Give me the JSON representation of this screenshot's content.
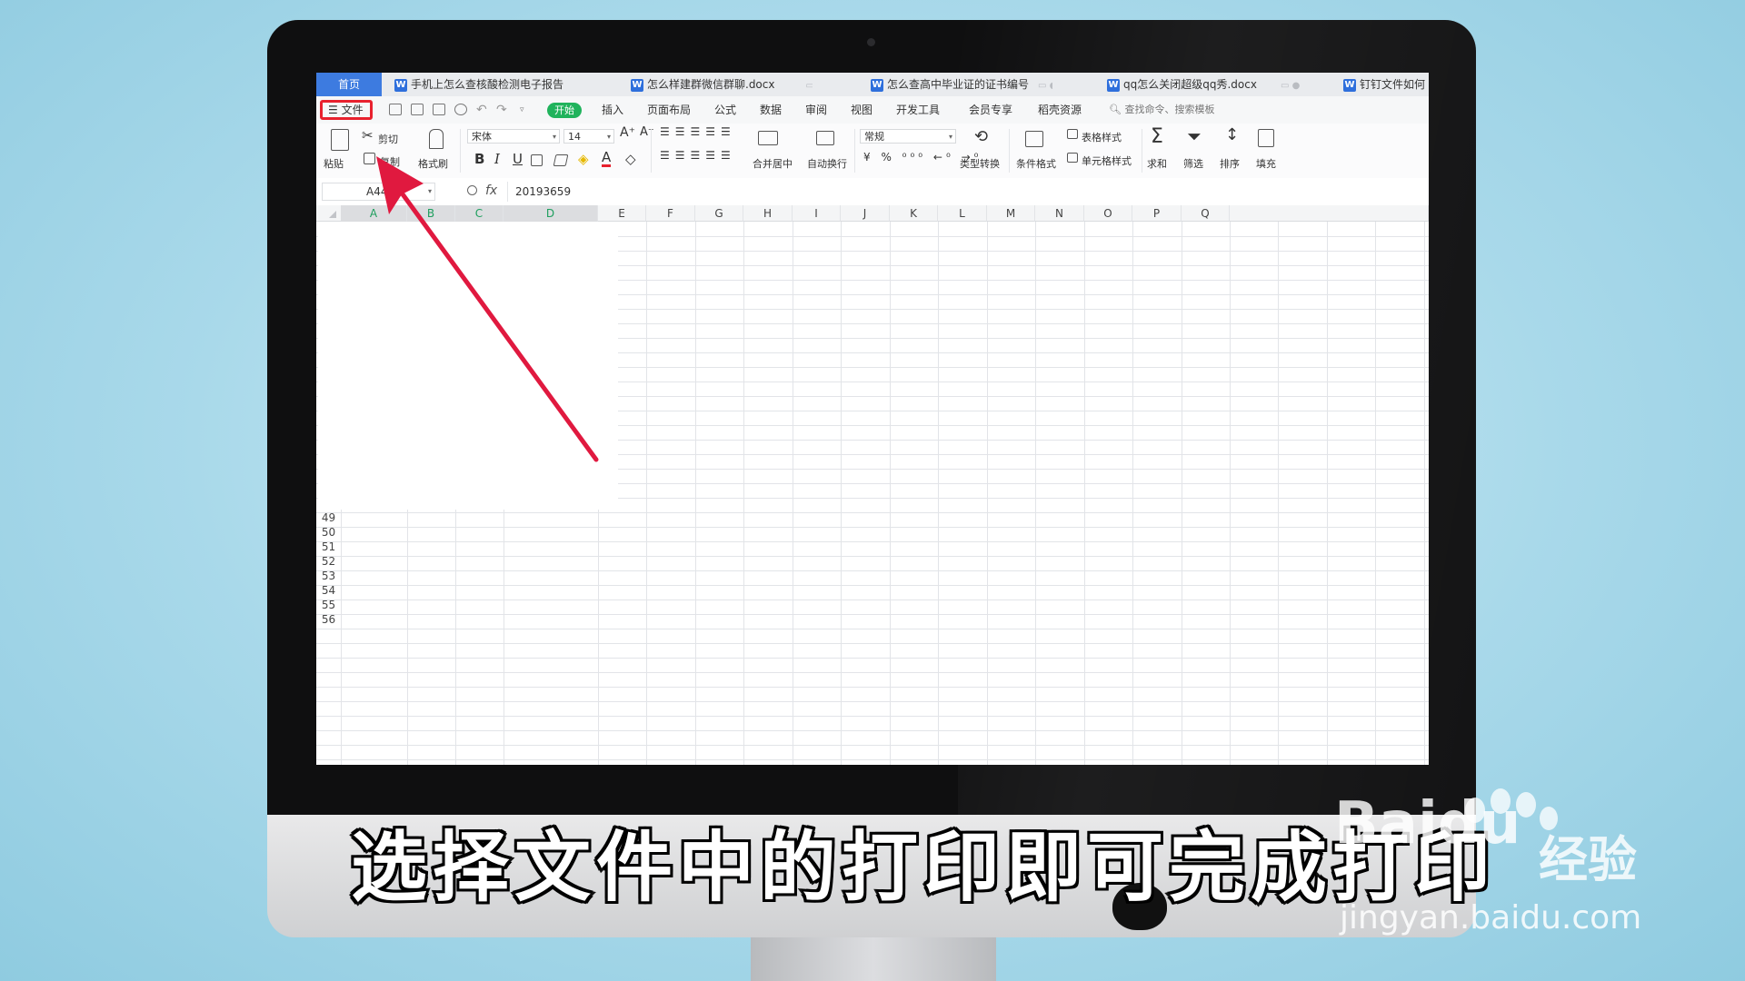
{
  "tabs": {
    "home": "首页",
    "docs": [
      {
        "icon": "W",
        "title": "手机上怎么查核酸检测电子报告"
      },
      {
        "icon": "W",
        "title": "怎么样建群微信群聊.docx"
      },
      {
        "icon": "W",
        "title": "怎么查高中毕业证的证书编号"
      },
      {
        "icon": "W",
        "title": "qq怎么关闭超级qq秀.docx"
      },
      {
        "icon": "W",
        "title": "钉钉文件如何"
      }
    ]
  },
  "menu": {
    "file": "文件",
    "start": "开始",
    "items": [
      "插入",
      "页面布局",
      "公式",
      "数据",
      "审阅",
      "视图",
      "开发工具",
      "会员专享",
      "稻壳资源"
    ],
    "search": "查找命令、搜索模板"
  },
  "ribbon": {
    "paste": "粘贴",
    "cut": "剪切",
    "copy": "复制",
    "format_painter": "格式刷",
    "font_name": "宋体",
    "font_size": "14",
    "bold": "B",
    "italic": "I",
    "underline": "U",
    "merge_center": "合并居中",
    "wrap_text": "自动换行",
    "number_format": "常规",
    "type_convert": "类型转换",
    "conditional_format": "条件格式",
    "table_style": "表格样式",
    "cell_style": "单元格样式",
    "sum": "求和",
    "filter": "筛选",
    "sort": "排序",
    "fill": "填充"
  },
  "formula_bar": {
    "cell_ref": "A44",
    "fx": "fx",
    "value": "20193659"
  },
  "grid": {
    "columns": [
      "A",
      "B",
      "C",
      "D",
      "E",
      "F",
      "G",
      "H",
      "I",
      "J",
      "K",
      "L",
      "M",
      "N",
      "O",
      "P",
      "Q"
    ],
    "rows": [
      "49",
      "50",
      "51",
      "52",
      "53",
      "54",
      "55",
      "56"
    ]
  },
  "caption": "选择文件中的打印即可完成打印",
  "watermark": {
    "logo_latin": "Bai",
    "logo_du": "du",
    "logo_cn": "经验",
    "url": "jingyan.baidu.com"
  },
  "colors": {
    "highlight": "#e8212e",
    "arrow": "#e0193f",
    "start": "#20b35c",
    "home_tab": "#3d7be0"
  }
}
